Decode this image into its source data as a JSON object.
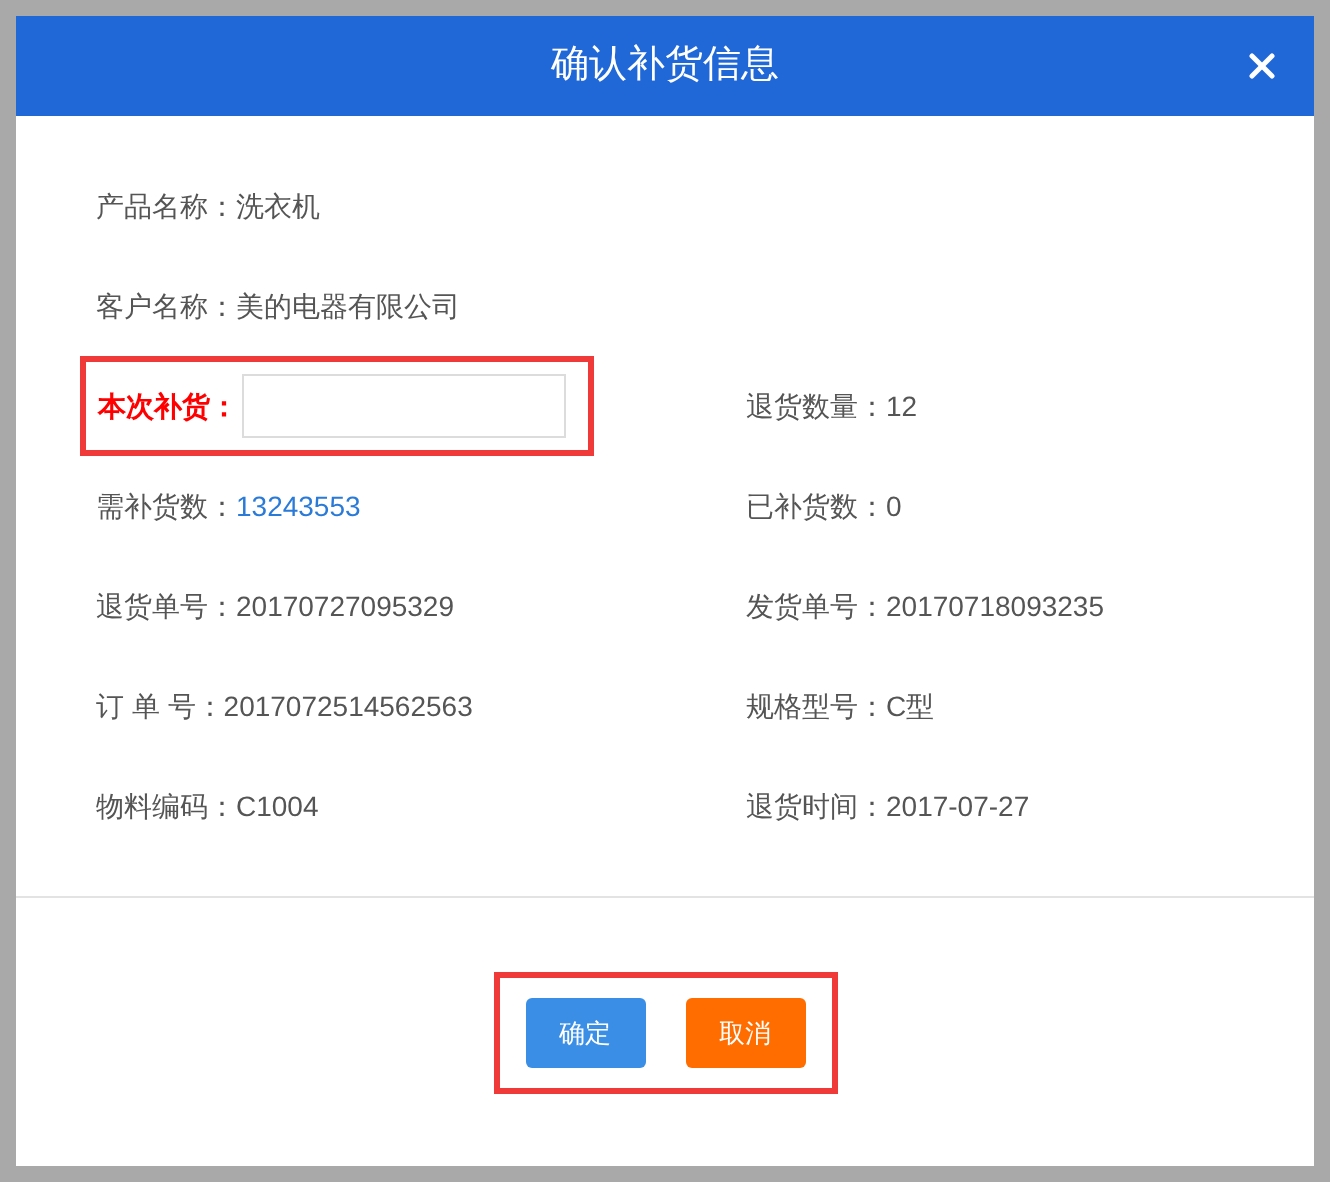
{
  "dialog": {
    "title": "确认补货信息",
    "rows": [
      [
        {
          "kind": "text",
          "label": "产品名称：",
          "value": "洗衣机"
        }
      ],
      [
        {
          "kind": "text",
          "label": "客户名称：",
          "value": "美的电器有限公司"
        }
      ],
      [
        {
          "kind": "input",
          "label": "本次补货：",
          "highlighted": true
        },
        {
          "kind": "text",
          "label": "退货数量：",
          "value": "12"
        }
      ],
      [
        {
          "kind": "link",
          "label": "需补货数：",
          "value": "13243553"
        },
        {
          "kind": "text",
          "label": "已补货数：",
          "value": "0"
        }
      ],
      [
        {
          "kind": "text",
          "label": "退货单号：",
          "value": "20170727095329"
        },
        {
          "kind": "text",
          "label": "发货单号：",
          "value": "20170718093235"
        }
      ],
      [
        {
          "kind": "text",
          "label": "订 单 号：",
          "value": "2017072514562563"
        },
        {
          "kind": "text",
          "label": "规格型号：",
          "value": "C型"
        }
      ],
      [
        {
          "kind": "text",
          "label": "物料编码：",
          "value": "C1004"
        },
        {
          "kind": "text",
          "label": "退货时间：",
          "value": "2017-07-27"
        }
      ]
    ],
    "buttons_highlighted": true,
    "buttons": [
      {
        "label": "确定",
        "kind": "primary"
      },
      {
        "label": "取消",
        "kind": "cancel"
      }
    ]
  }
}
